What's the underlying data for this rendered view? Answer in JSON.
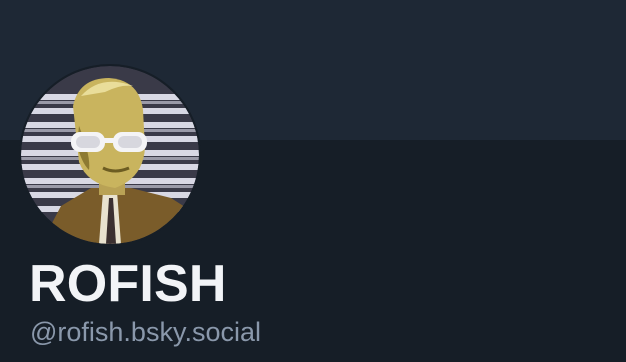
{
  "profile": {
    "display_name": "ROFISH",
    "handle": "@rofish.bsky.social",
    "avatar_icon": "avatar-image"
  },
  "colors": {
    "page_background": "#161e27",
    "banner_background": "#1e2835",
    "name_text": "#f2f4f7",
    "handle_text": "#8a98ab"
  }
}
